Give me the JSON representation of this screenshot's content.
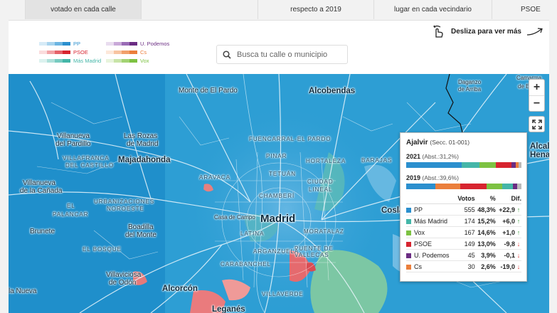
{
  "tabs": [
    {
      "label": "votado en cada calle"
    },
    {
      "label": "respecto a 2019"
    },
    {
      "label": "lugar en cada vecindario"
    },
    {
      "label": "PSOE"
    }
  ],
  "swipe_hint": "Desliza para ver más",
  "search": {
    "placeholder": "Busca tu calle o municipio"
  },
  "legend": [
    {
      "name": "PP",
      "color": "#2b8fce",
      "shades": [
        "#d6ebf7",
        "#a8d3ee",
        "#6cb5e2",
        "#2b8fce"
      ]
    },
    {
      "name": "U. Podemos",
      "color": "#6b2d83",
      "shades": [
        "#e9dcef",
        "#c9a9d8",
        "#9a6cb6",
        "#6b2d83"
      ]
    },
    {
      "name": "PSOE",
      "color": "#d7242f",
      "shades": [
        "#fadcdd",
        "#f2a3a7",
        "#e5626a",
        "#d7242f"
      ]
    },
    {
      "name": "Cs",
      "color": "#eb7f3c",
      "shades": [
        "#fde8da",
        "#f8c4a1",
        "#f1a06c",
        "#eb7f3c"
      ]
    },
    {
      "name": "Más Madrid",
      "color": "#44b6a8",
      "shades": [
        "#dcf2ef",
        "#aee0da",
        "#77cbc1",
        "#44b6a8"
      ]
    },
    {
      "name": "Vox",
      "color": "#7dc242",
      "shades": [
        "#e8f4dc",
        "#c8e4a8",
        "#a3d374",
        "#7dc242"
      ]
    }
  ],
  "map": {
    "places": {
      "monte_pardo": "Monte de El Pardo",
      "alcobendas": "Alcobendas",
      "dagante": "Daganzo",
      "arriba": "de Arriba",
      "camarma": "Camarma",
      "de_este": "de Este",
      "villanueva_pardillo_1": "Villanueva",
      "villanueva_pardillo_2": "del Pardillo",
      "rozas_1": "Las Rozas",
      "rozas_2": "de Madrid",
      "villafranca_1": "VILLAFRANCA",
      "villafranca_2": "DEL CASTILLO",
      "majadahonda": "Majadahonda",
      "villanueva_canada_1": "Villanueva",
      "villanueva_canada_2": "de la Cañada",
      "urbanizaciones_1": "URBANIZACIONES",
      "urbanizaciones_2": "NOROESTE",
      "palancar_1": "EL",
      "palancar_2": "PALANCAR",
      "brunete": "Brunete",
      "boadilla_1": "Boadilla",
      "boadilla_2": "del Monte",
      "bosque": "EL BOSQUE",
      "villaviciosa_1": "Villaviciosa",
      "villaviciosa_2": "de Odón",
      "sevilla_nueva": "la Nueva",
      "alcorcon": "Alcorcón",
      "leganes": "Leganés",
      "villaverde": "VILLAVERDE",
      "carabanchel": "CARABANCHEL",
      "latina": "LATINA",
      "madrid": "Madrid",
      "casa_campo": "Casa de Campo",
      "moratalaz": "MORATALAZ",
      "puente_1": "PUENTE DE",
      "puente_2": "VALLECAS",
      "arganzuela": "ARGANZUELA",
      "chamberi": "CHAMBERÍ",
      "ciudad_lineal_1": "CIUDAD",
      "ciudad_lineal_2": "LINEAL",
      "tetuan": "TETUÁN",
      "hortaleza": "HORTALEZA",
      "barajas": "BARAJAS",
      "aravaca": "ARAVACA",
      "fuencarral": "FUENCARRAL-EL PARDO",
      "pinar": "PINAR",
      "coslada": "Cosla",
      "alcala_1": "Alcal",
      "alcala_2": "Henar"
    }
  },
  "popup": {
    "name": "Ajalvir",
    "section": "(Secc. 01-001)",
    "year_2021": "2021",
    "abst_2021": "(Abst.:31,2%)",
    "year_2019": "2019",
    "abst_2019": "(Abst.:39,6%)",
    "bar_2021": [
      {
        "party": "PP",
        "pct": 48.3,
        "color": "#2b8fce"
      },
      {
        "party": "Más Madrid",
        "pct": 15.2,
        "color": "#44b6a8"
      },
      {
        "party": "Vox",
        "pct": 14.6,
        "color": "#7dc242"
      },
      {
        "party": "PSOE",
        "pct": 13.0,
        "color": "#d7242f"
      },
      {
        "party": "U. Podemos",
        "pct": 3.9,
        "color": "#6b2d83"
      },
      {
        "party": "Cs",
        "pct": 2.6,
        "color": "#eb7f3c"
      },
      {
        "party": "Otros",
        "pct": 2.4,
        "color": "#bbbbbb"
      }
    ],
    "bar_2019": [
      {
        "party": "PP",
        "pct": 25.4,
        "color": "#2b8fce"
      },
      {
        "party": "Cs",
        "pct": 21.6,
        "color": "#eb7f3c"
      },
      {
        "party": "PSOE",
        "pct": 22.8,
        "color": "#d7242f"
      },
      {
        "party": "Vox",
        "pct": 13.6,
        "color": "#7dc242"
      },
      {
        "party": "Más Madrid",
        "pct": 9.2,
        "color": "#44b6a8"
      },
      {
        "party": "U. Podemos",
        "pct": 4.0,
        "color": "#6b2d83"
      },
      {
        "party": "Otros",
        "pct": 3.4,
        "color": "#bbbbbb"
      }
    ],
    "headers": {
      "votos": "Votos",
      "pct": "%",
      "dif": "Dif."
    },
    "rows": [
      {
        "party": "PP",
        "color": "#2b8fce",
        "votos": "555",
        "pct": "48,3%",
        "dif": "+22,9",
        "dir": "up"
      },
      {
        "party": "Más Madrid",
        "color": "#44b6a8",
        "votos": "174",
        "pct": "15,2%",
        "dif": "+6,0",
        "dir": "up"
      },
      {
        "party": "Vox",
        "color": "#7dc242",
        "votos": "167",
        "pct": "14,6%",
        "dif": "+1,0",
        "dir": "up"
      },
      {
        "party": "PSOE",
        "color": "#d7242f",
        "votos": "149",
        "pct": "13,0%",
        "dif": "-9,8",
        "dir": "down"
      },
      {
        "party": "U. Podemos",
        "color": "#6b2d83",
        "votos": "45",
        "pct": "3,9%",
        "dif": "-0,1",
        "dir": "down"
      },
      {
        "party": "Cs",
        "color": "#eb7f3c",
        "votos": "30",
        "pct": "2,6%",
        "dif": "-19,0",
        "dir": "down"
      }
    ]
  },
  "controls": {
    "zoom_in": "+",
    "zoom_out": "−"
  }
}
